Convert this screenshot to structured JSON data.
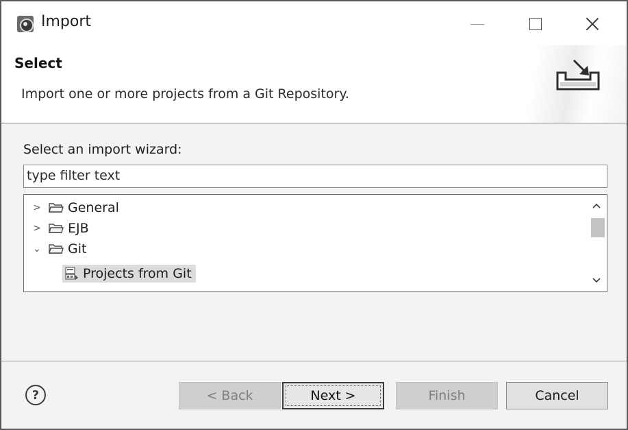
{
  "window": {
    "title": "Import",
    "icon": "eclipse-app-icon",
    "controls": [
      "minimize-icon",
      "maximize-icon",
      "close-icon"
    ]
  },
  "banner": {
    "title": "Select",
    "description": "Import one or more projects from a Git Repository.",
    "icon": "import-wizard-icon"
  },
  "wizard": {
    "label": "Select an import wizard:",
    "filter_placeholder": "type filter text",
    "tree": [
      {
        "label": "General",
        "expanded": false,
        "icon": "folder-icon",
        "twisty": ">"
      },
      {
        "label": "EJB",
        "expanded": false,
        "icon": "folder-icon",
        "twisty": ">"
      },
      {
        "label": "Git",
        "expanded": true,
        "icon": "folder-icon",
        "twisty": "⌄",
        "children": [
          {
            "label": "Projects from Git",
            "selected": true,
            "icon": "git-projects-icon"
          }
        ]
      }
    ]
  },
  "footer": {
    "help_label": "?",
    "back_label": "< Back",
    "next_label": "Next >",
    "finish_label": "Finish",
    "cancel_label": "Cancel",
    "back_enabled": false,
    "finish_enabled": false
  },
  "colors": {
    "window_bg": "#f3f3f3",
    "selection_bg": "#dcdcdc",
    "disabled_button_bg": "#cfcfcf",
    "border": "#5a5a5a"
  }
}
